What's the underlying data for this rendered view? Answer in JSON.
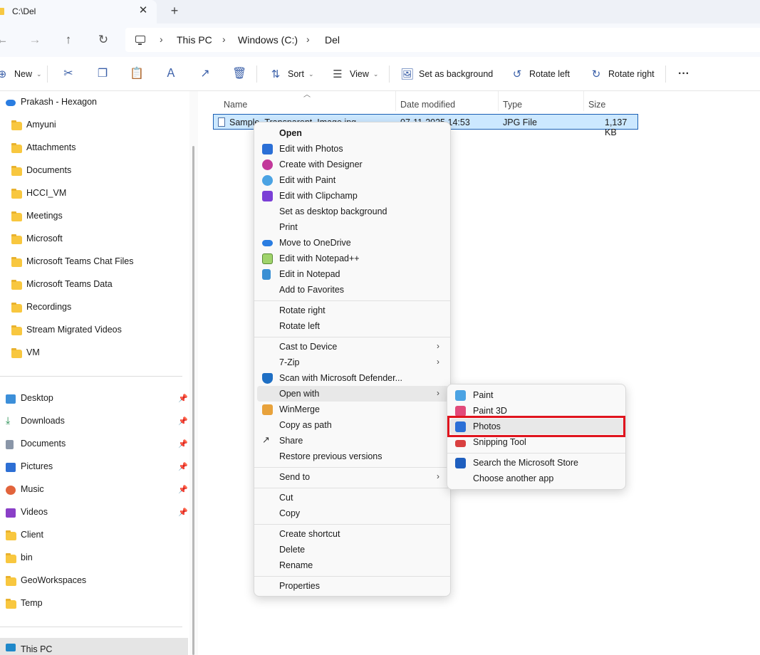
{
  "window": {
    "tab_title": "C:\\Del",
    "close_glyph": "✕",
    "new_tab_glyph": "+"
  },
  "address": {
    "crumbs": [
      "This PC",
      "Windows (C:)",
      "Del"
    ],
    "separator": "›"
  },
  "toolbar": {
    "new_label": "New",
    "sort_label": "Sort",
    "view_label": "View",
    "set_background_label": "Set as background",
    "rotate_left_label": "Rotate left",
    "rotate_right_label": "Rotate right",
    "more_glyph": "···"
  },
  "sidebar": {
    "cloud_item": "Prakash - Hexagon",
    "folders": [
      "Amyuni",
      "Attachments",
      "Documents",
      "HCCI_VM",
      "Meetings",
      "Microsoft",
      "Microsoft Teams Chat Files",
      "Microsoft Teams Data",
      "Recordings",
      "Stream Migrated Videos",
      "VM"
    ],
    "quick_access": [
      "Desktop",
      "Downloads",
      "Documents",
      "Pictures",
      "Music",
      "Videos",
      "Client",
      "bin",
      "GeoWorkspaces",
      "Temp"
    ],
    "this_pc": "This PC",
    "pin_glyph": "📌"
  },
  "file_list": {
    "columns": [
      "Name",
      "Date modified",
      "Type",
      "Size"
    ],
    "rows": [
      {
        "name": "Sample_Transparent_Image.jpg",
        "date": "07-11-2025 14:53",
        "type": "JPG File",
        "size": "1,137 KB"
      }
    ]
  },
  "context_menu": {
    "items": {
      "open": "Open",
      "edit_photos": "Edit with Photos",
      "create_designer": "Create with Designer",
      "edit_paint": "Edit with Paint",
      "edit_clipchamp": "Edit with Clipchamp",
      "set_desktop_bg": "Set as desktop background",
      "print": "Print",
      "move_onedrive": "Move to OneDrive",
      "edit_notepadpp": "Edit with Notepad++",
      "edit_notepad": "Edit in Notepad",
      "add_favorites": "Add to Favorites",
      "rotate_right": "Rotate right",
      "rotate_left": "Rotate left",
      "cast_device": "Cast to Device",
      "seven_zip": "7-Zip",
      "scan_defender": "Scan with Microsoft Defender...",
      "open_with": "Open with",
      "winmerge": "WinMerge",
      "copy_path": "Copy as path",
      "share": "Share",
      "restore_versions": "Restore previous versions",
      "send_to": "Send to",
      "cut": "Cut",
      "copy": "Copy",
      "create_shortcut": "Create shortcut",
      "delete": "Delete",
      "rename": "Rename",
      "properties": "Properties"
    },
    "arrow_glyph": "›"
  },
  "open_with_submenu": {
    "items": [
      "Paint",
      "Paint 3D",
      "Photos",
      "Snipping Tool",
      "Search the Microsoft Store",
      "Choose another app"
    ],
    "highlighted": "Photos",
    "highlight_color": "#e0141e"
  }
}
